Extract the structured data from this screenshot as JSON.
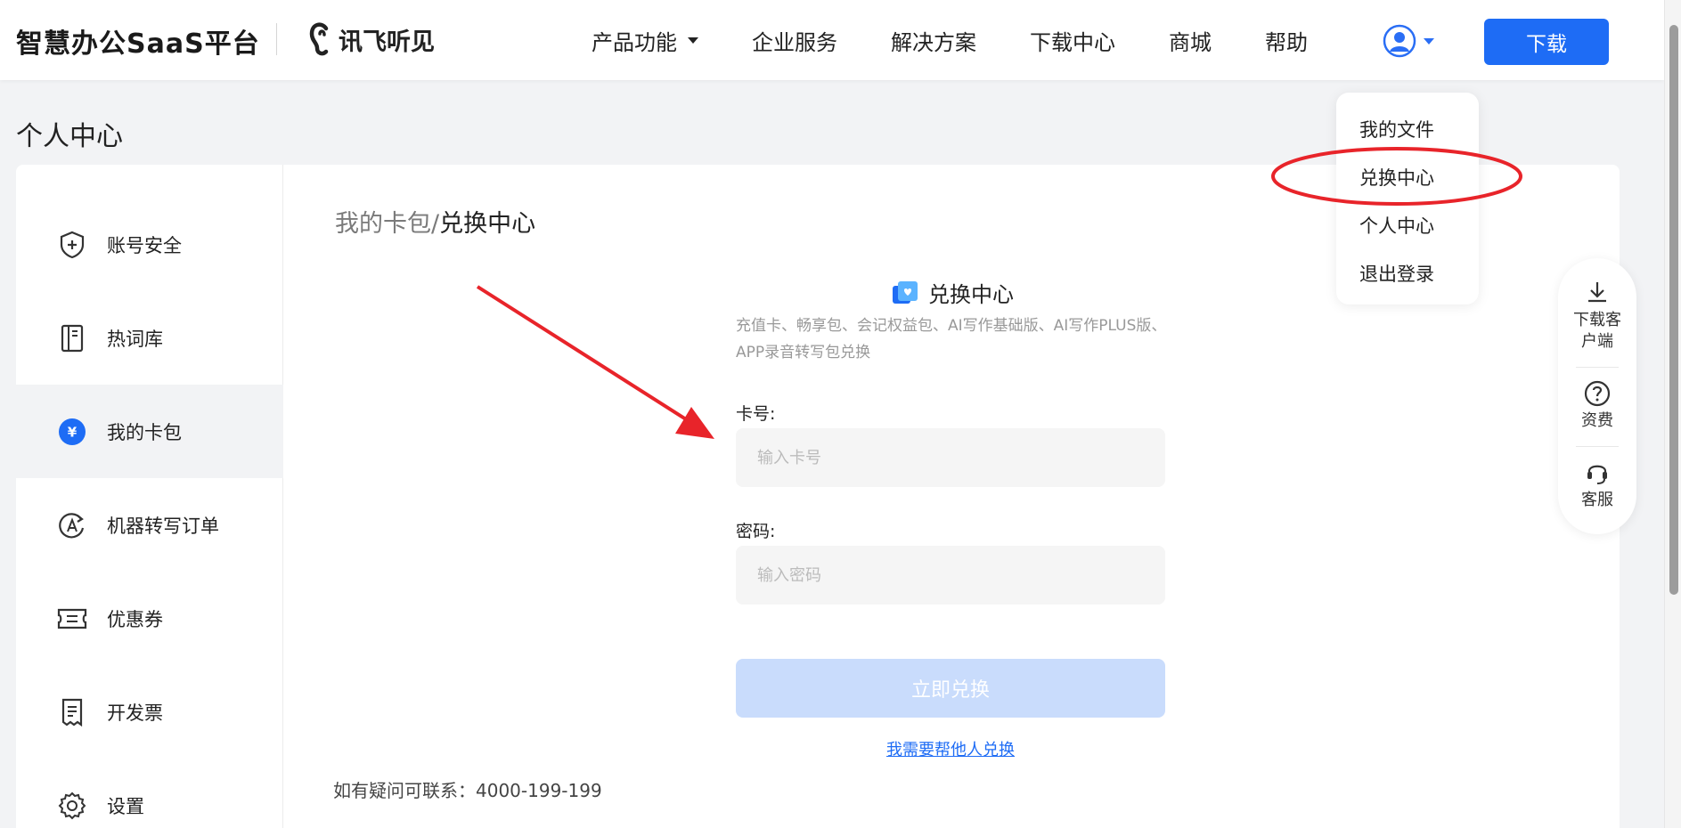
{
  "header": {
    "brand_title": "智慧办公SaaS平台",
    "logo_text": "讯飞听见",
    "nav": [
      "产品功能",
      "企业服务",
      "解决方案",
      "下载中心",
      "商城",
      "帮助"
    ],
    "download_label": "下载"
  },
  "page_title": "个人中心",
  "sidebar": {
    "items": [
      {
        "label": "账号安全",
        "icon": "shield-plus-icon"
      },
      {
        "label": "热词库",
        "icon": "notebook-icon"
      },
      {
        "label": "我的卡包",
        "icon": "yen-circle-icon",
        "active": true
      },
      {
        "label": "机器转写订单",
        "icon": "transcribe-icon"
      },
      {
        "label": "优惠券",
        "icon": "coupon-icon"
      },
      {
        "label": "开发票",
        "icon": "invoice-icon"
      },
      {
        "label": "设置",
        "icon": "gear-icon"
      }
    ]
  },
  "breadcrumb": {
    "prev": "我的卡包/",
    "current": "兑换中心"
  },
  "redeem": {
    "title": "兑换中心",
    "desc": "充值卡、畅享包、会记权益包、AI写作基础版、AI写作PLUS版、APP录音转写包兑换",
    "card_label": "卡号:",
    "card_placeholder": "输入卡号",
    "pwd_label": "密码:",
    "pwd_placeholder": "输入密码",
    "submit": "立即兑换",
    "help_link": "我需要帮他人兑换"
  },
  "contact": "如有疑问可联系：4000-199-199",
  "user_menu": [
    "我的文件",
    "兑换中心",
    "个人中心",
    "退出登录"
  ],
  "float_panel": [
    {
      "label": "下载客户端",
      "icon": "download-icon"
    },
    {
      "label": "资费",
      "icon": "question-circle-icon"
    },
    {
      "label": "客服",
      "icon": "headset-icon"
    }
  ],
  "colors": {
    "primary": "#1e6cf5",
    "annotation": "#e8242a",
    "disabled_button": "#c9dcfc"
  }
}
